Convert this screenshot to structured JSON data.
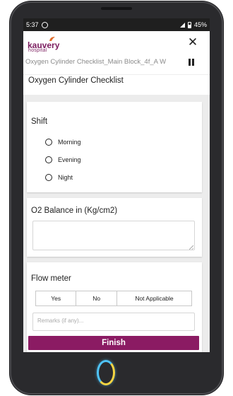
{
  "statusbar": {
    "time": "5:37",
    "network": "∞₄⁴ᴳ+",
    "battery": "45%"
  },
  "header": {
    "logo_text": "kauvery",
    "logo_sub": "hospital",
    "subtitle": "Oxygen Cylinder Checklist_Main Block_4f_A W"
  },
  "page_title": "Oxygen Cylinder Checklist",
  "shift": {
    "label": "Shift",
    "options": [
      "Morning",
      "Evening",
      "Night"
    ]
  },
  "o2": {
    "label": "O2 Balance in (Kg/cm2)",
    "value": ""
  },
  "flow": {
    "label": "Flow meter",
    "options": [
      "Yes",
      "No",
      "Not Applicable"
    ],
    "remarks_placeholder": "Remarks (if any)..."
  },
  "finish_label": "Finish",
  "colors": {
    "brand": "#8b1b63",
    "logo": "#7b1c5e",
    "content_bg": "#ececec"
  }
}
